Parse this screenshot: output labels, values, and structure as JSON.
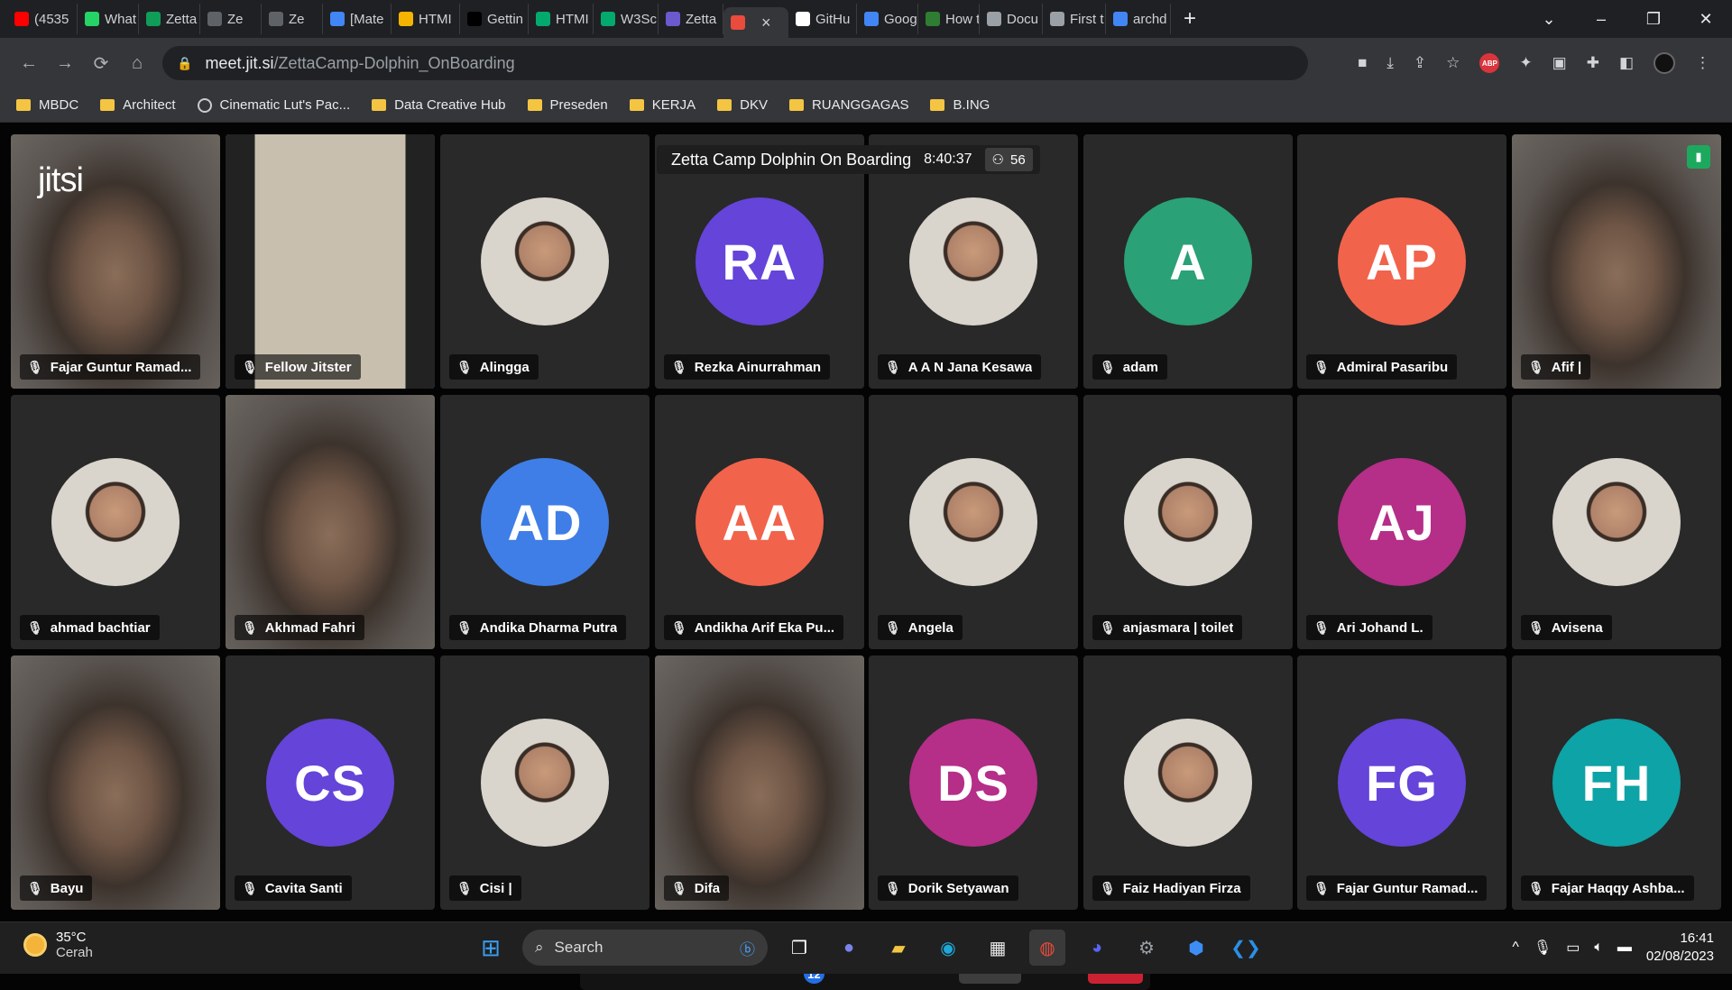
{
  "browser": {
    "tabs": [
      {
        "label": "(4535",
        "icon": "youtube-icon",
        "color": "#ff0000"
      },
      {
        "label": "What",
        "icon": "whatsapp-icon",
        "color": "#25d366"
      },
      {
        "label": "Zetta",
        "icon": "sheets-icon",
        "color": "#0f9d58"
      },
      {
        "label": "Ze",
        "icon": "audio-icon",
        "color": "#5f6368"
      },
      {
        "label": "Ze",
        "icon": "record-icon",
        "color": "#5f6368"
      },
      {
        "label": "[Mate",
        "icon": "docs-icon",
        "color": "#4285f4"
      },
      {
        "label": "HTMI",
        "icon": "drive-icon",
        "color": "#f4b400"
      },
      {
        "label": "Gettin",
        "icon": "medium-icon",
        "color": "#000000"
      },
      {
        "label": "HTMI",
        "icon": "w3-icon",
        "color": "#04aa6d"
      },
      {
        "label": "W3Sc",
        "icon": "w3-icon",
        "color": "#04aa6d"
      },
      {
        "label": "Zetta",
        "icon": "zetta-icon",
        "color": "#6a5acd"
      },
      {
        "label": "",
        "icon": "record-icon",
        "color": "#e94b3c",
        "active": true
      },
      {
        "label": "GitHu",
        "icon": "github-icon",
        "color": "#ffffff"
      },
      {
        "label": "Goog",
        "icon": "google-icon",
        "color": "#4285f4"
      },
      {
        "label": "How t",
        "icon": "site-icon",
        "color": "#2e7d32"
      },
      {
        "label": "Docu",
        "icon": "globe-icon",
        "color": "#9aa0a6"
      },
      {
        "label": "First t",
        "icon": "globe-icon",
        "color": "#9aa0a6"
      },
      {
        "label": "archd",
        "icon": "google-icon",
        "color": "#4285f4"
      }
    ],
    "active_tab_close": "×",
    "new_tab": "+",
    "url_host": "meet.jit.si",
    "url_path": "/ZettaCamp-Dolphin_OnBoarding",
    "bookmarks": [
      {
        "label": "MBDC",
        "type": "folder"
      },
      {
        "label": "Architect",
        "type": "folder"
      },
      {
        "label": "Cinematic Lut's Pac...",
        "type": "globe"
      },
      {
        "label": "Data Creative Hub",
        "type": "folder"
      },
      {
        "label": "Preseden",
        "type": "folder"
      },
      {
        "label": "KERJA",
        "type": "folder"
      },
      {
        "label": "DKV",
        "type": "folder"
      },
      {
        "label": "RUANGGAGAS",
        "type": "folder"
      },
      {
        "label": "B.ING",
        "type": "folder"
      }
    ],
    "abp_label": "ABP"
  },
  "meeting": {
    "logo_text": "jitsi",
    "title": "Zetta Camp Dolphin On Boarding",
    "duration": "8:40:37",
    "participant_count": "56",
    "participants": [
      {
        "name": "Fajar Guntur Ramad...",
        "kind": "video"
      },
      {
        "name": "Fellow Jitster",
        "kind": "video",
        "selected": true
      },
      {
        "name": "Alingga",
        "kind": "photo"
      },
      {
        "name": "Rezka Ainurrahman",
        "kind": "initials",
        "initials": "RA",
        "color": "#6544d9"
      },
      {
        "name": "A A N Jana Kesawa",
        "kind": "photo"
      },
      {
        "name": "adam",
        "kind": "initials",
        "initials": "A",
        "color": "#2aa176"
      },
      {
        "name": "Admiral Pasaribu",
        "kind": "initials",
        "initials": "AP",
        "color": "#f2634b"
      },
      {
        "name": "Afif |",
        "kind": "video"
      },
      {
        "name": "ahmad bachtiar",
        "kind": "photo"
      },
      {
        "name": "Akhmad Fahri",
        "kind": "video"
      },
      {
        "name": "Andika Dharma Putra",
        "kind": "initials",
        "initials": "AD",
        "color": "#3f7ee6"
      },
      {
        "name": "Andikha Arif Eka Pu...",
        "kind": "initials",
        "initials": "AA",
        "color": "#f2634b"
      },
      {
        "name": "Angela",
        "kind": "photo"
      },
      {
        "name": "anjasmara | toilet",
        "kind": "photo"
      },
      {
        "name": "Ari Johand L.",
        "kind": "initials",
        "initials": "AJ",
        "color": "#b52e88"
      },
      {
        "name": "Avisena",
        "kind": "photo"
      },
      {
        "name": "Bayu",
        "kind": "video"
      },
      {
        "name": "Cavita Santi",
        "kind": "initials",
        "initials": "CS",
        "color": "#6544d9"
      },
      {
        "name": "Cisi |",
        "kind": "photo"
      },
      {
        "name": "Difa",
        "kind": "video"
      },
      {
        "name": "Dorik Setyawan",
        "kind": "initials",
        "initials": "DS",
        "color": "#b52e88"
      },
      {
        "name": "Faiz Hadiyan Firza",
        "kind": "photo"
      },
      {
        "name": "Fajar Guntur Ramad...",
        "kind": "initials",
        "initials": "FG",
        "color": "#6544d9"
      },
      {
        "name": "Fajar Haqqy Ashba...",
        "kind": "initials",
        "initials": "FH",
        "color": "#0ea3a6"
      }
    ],
    "controls": {
      "chat_badge": "12",
      "participants_badge": "56"
    }
  },
  "taskbar": {
    "temperature": "35°C",
    "weather": "Cerah",
    "search_label": "Search",
    "time": "16:41",
    "date": "02/08/2023"
  }
}
